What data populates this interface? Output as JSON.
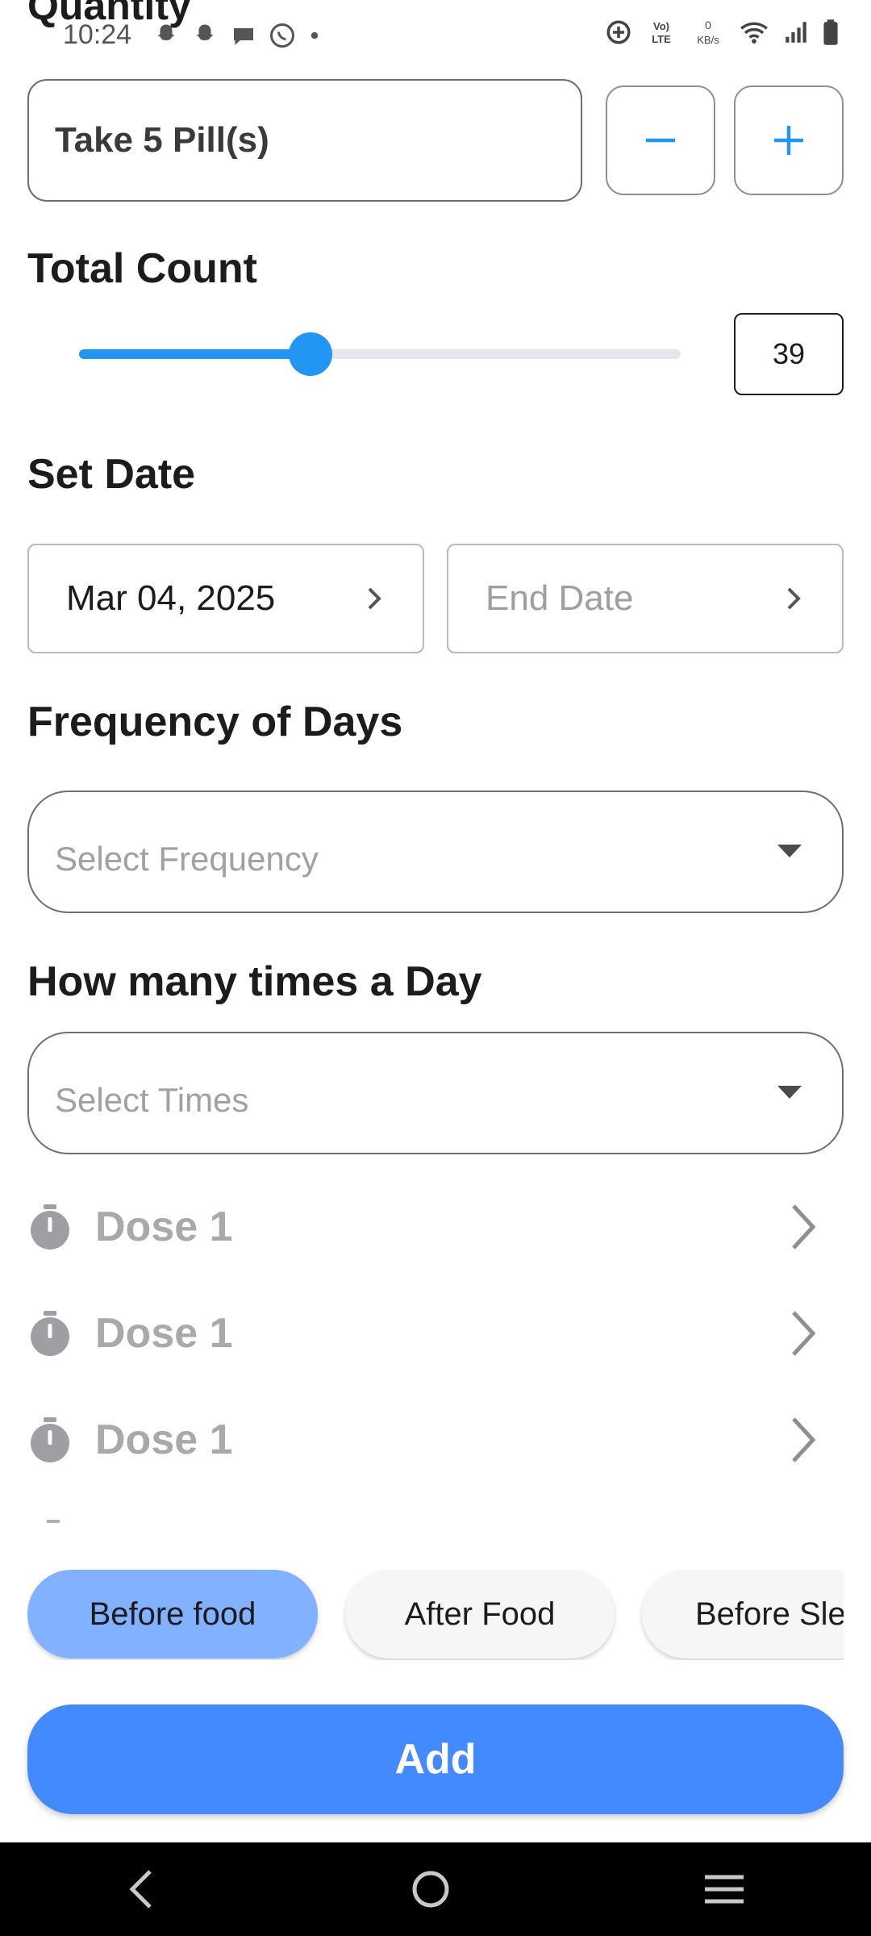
{
  "status_bar": {
    "time": "10:24",
    "left_icons": [
      "snapchat-icon",
      "snapchat-icon",
      "chat-icon",
      "whatsapp-icon",
      "dot-icon"
    ],
    "right_icons": [
      "data-saver-icon",
      "volte-icon",
      "network-speed-icon",
      "wifi-icon",
      "signal-icon",
      "battery-icon"
    ],
    "volte_label": "Vo) LTE",
    "speed_value": "0",
    "speed_unit": "KB/s"
  },
  "quantity": {
    "heading": "Quantity",
    "value": "Take 5 Pill(s)",
    "minus_icon": "minus-icon",
    "plus_icon": "plus-icon"
  },
  "total_count": {
    "heading": "Total Count",
    "value": "39",
    "slider_fraction": 0.385
  },
  "set_date": {
    "heading": "Set Date",
    "start_date": "Mar 04, 2025",
    "end_placeholder": "End Date"
  },
  "frequency": {
    "heading": "Frequency of Days",
    "placeholder": "Select Frequency"
  },
  "times_per_day": {
    "heading": "How many times a Day",
    "placeholder": "Select Times"
  },
  "doses": [
    {
      "label": "Dose 1",
      "icon": "timer-icon"
    },
    {
      "label": "Dose 1",
      "icon": "timer-icon"
    },
    {
      "label": "Dose 1",
      "icon": "timer-icon"
    }
  ],
  "food_chips": [
    {
      "label": "Before food",
      "selected": true
    },
    {
      "label": "After Food",
      "selected": false
    },
    {
      "label": "Before Sleep",
      "selected": false
    }
  ],
  "add_button": "Add",
  "colors": {
    "accent": "#2196f3",
    "primary_button": "#448aff",
    "selected_chip": "#82b1ff"
  }
}
